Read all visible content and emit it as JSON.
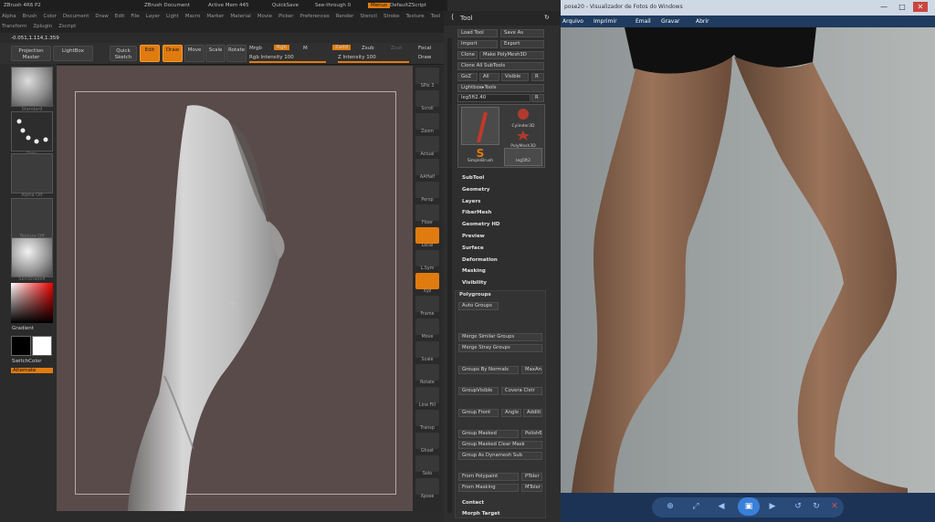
{
  "zbrush": {
    "title_items": [
      "ZBrush 4R6 P2",
      "ZBrush Document",
      "Active Mem 445",
      "QuickSave",
      "See-through 0",
      "Menus",
      "DefaultZScript"
    ],
    "menu_row1": [
      "Alpha",
      "Brush",
      "Color",
      "Document",
      "Draw",
      "Edit",
      "File",
      "Layer",
      "Light",
      "Macro",
      "Marker",
      "Material",
      "Movie",
      "Picker",
      "Preferences",
      "Render",
      "Stencil",
      "Stroke",
      "Texture",
      "Tool"
    ],
    "menu_row2": [
      "Transform",
      "Zplugin",
      "Zscript"
    ],
    "coords": "-0.051,1.114,1.359",
    "toolbar": {
      "projection_master": "Projection Master",
      "lightbox": "LightBox",
      "quick_sketch": "Quick Sketch",
      "edit": "Edit",
      "draw": "Draw",
      "move": "Move",
      "scale": "Scale",
      "rotate": "Rotate",
      "mrgb": "Mrgb",
      "rgb": "Rgb",
      "m": "M",
      "rgb_intensity": "Rgb Intensity 100",
      "zadd": "Zadd",
      "zsub": "Zsub",
      "zcut": "Zcut",
      "z_intensity": "Z Intensity 100",
      "focal": "Focal",
      "draw_size": "Draw"
    },
    "left_shelf": {
      "brush_label": "Standard",
      "stroke_label": "Dots",
      "alpha_label": "Alpha Off",
      "texture_label": "Texture Off",
      "material_label": "SkinShade4",
      "gradient": "Gradient",
      "switch_color": "SwitchColor",
      "alternate": "Alternate"
    },
    "right_shelf": [
      "SPix 3",
      "Scroll",
      "Zoom",
      "Actual",
      "AAHalf",
      "Persp",
      "Floor",
      "Local",
      "L.Sym",
      "Xyz",
      "Frame",
      "Move",
      "Scale",
      "Rotate",
      "Line Fill",
      "Transp",
      "Ghost",
      "Solo",
      "Xpose"
    ],
    "tool_panel": {
      "header": "Tool",
      "load_tool": "Load Tool",
      "save_as": "Save As",
      "import": "Import",
      "export": "Export",
      "clone": "Clone",
      "make_polymesh": "Make PolyMesh3D",
      "clone_all": "Clone All SubTools",
      "goz": "GoZ",
      "all": "All",
      "visible": "Visible",
      "r": "R",
      "lightbox_tools": "Lightbox▸Tools",
      "leg_value": "leg5ft2.40",
      "tools": [
        "leg5ft2",
        "Cylinder3D",
        "PolyMesh3D",
        "SimpleBrush",
        "leg5ft2"
      ],
      "sections": [
        "SubTool",
        "Geometry",
        "Layers",
        "FiberMesh",
        "Geometry HD",
        "Preview",
        "Surface",
        "Deformation",
        "Masking",
        "Visibility"
      ],
      "polygroups_header": "Polygroups",
      "auto_groups": "Auto Groups",
      "merge_similar": "Merge Similar Groups",
      "merge_stray": "Merge Stray Groups",
      "groups_by_normals": "Groups By Normals",
      "maxangle": "MaxAn",
      "groupvisible": "GroupVisible",
      "coverage": "Covera Clstr",
      "group_front": "Group Front",
      "angle": "Angle",
      "additive": "Additi",
      "group_masked": "Group Masked",
      "polish": "Polish6",
      "group_masked_clear": "Group Masked Clear Mask",
      "group_as_dynamesh": "Group As Dynamesh Sub",
      "from_polypaint": "From Polypaint",
      "ptoler": "PToler",
      "from_masking": "From Masking",
      "mtoler": "MToler",
      "contact": "Contact",
      "morph_target": "Morph Target"
    }
  },
  "viewer": {
    "title": "pose20 - Visualizador de Fotos do Windows",
    "menu": [
      "Arquivo",
      "Imprimir",
      "Email",
      "Gravar",
      "Abrir"
    ],
    "window_buttons": [
      "—",
      "□",
      "✕"
    ]
  }
}
